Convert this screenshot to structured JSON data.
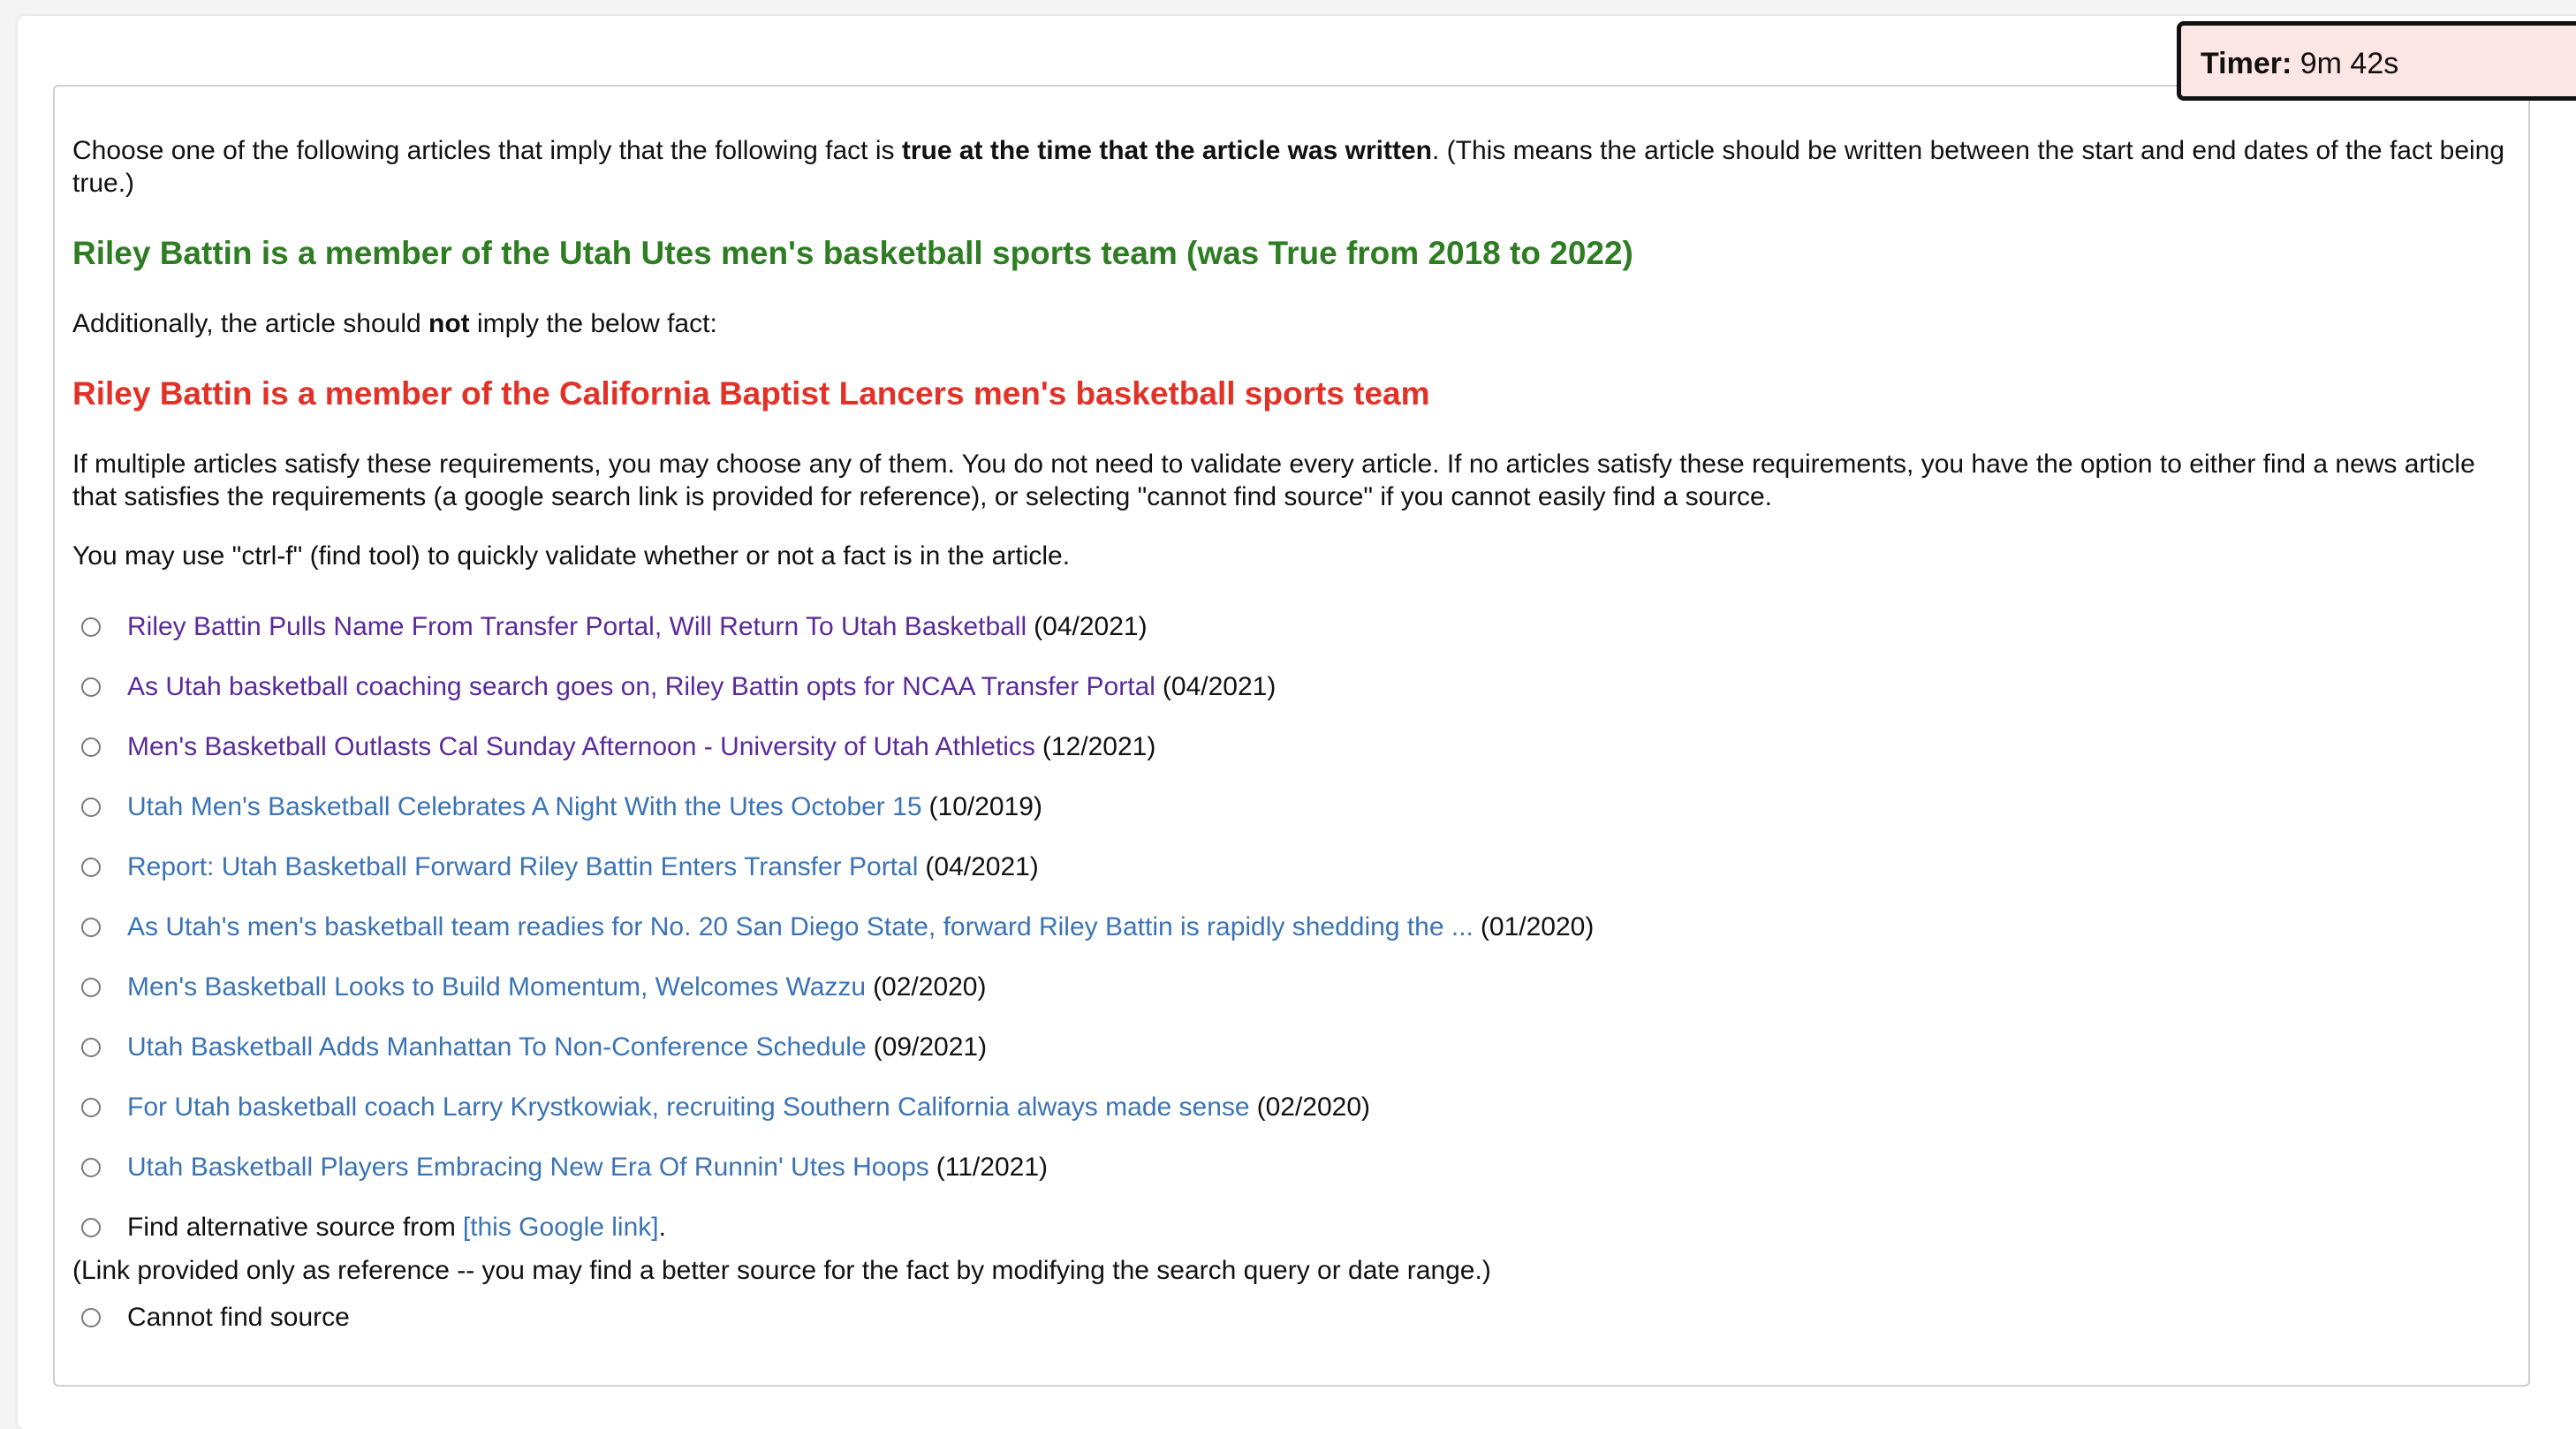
{
  "timer": {
    "label": "Timer:",
    "value": "9m 42s"
  },
  "instructions": {
    "p1_prefix": "Choose one of the following articles that imply that the following fact is ",
    "p1_bold": "true at the time that the article was written",
    "p1_suffix": ". (This means the article should be written between the start and end dates of the fact being true.)",
    "fact_true": "Riley Battin is a member of the Utah Utes men's basketball sports team (was True from 2018 to 2022)",
    "p2_prefix": "Additionally, the article should ",
    "p2_bold": "not",
    "p2_suffix": " imply the below fact:",
    "fact_false": "Riley Battin is a member of the California Baptist Lancers men's basketball sports team",
    "p3": "If multiple articles satisfy these requirements, you may choose any of them. You do not need to validate every article. If no articles satisfy these requirements, you have the option to either find a news article that satisfies the requirements (a google search link is provided for reference), or selecting \"cannot find source\" if you cannot easily find a source.",
    "p4": "You may use \"ctrl-f\" (find tool) to quickly validate whether or not a fact is in the article."
  },
  "articles": [
    {
      "title": "Riley Battin Pulls Name From Transfer Portal, Will Return To Utah Basketball",
      "date": "(04/2021)",
      "visited": true
    },
    {
      "title": "As Utah basketball coaching search goes on, Riley Battin opts for NCAA Transfer Portal",
      "date": "(04/2021)",
      "visited": true
    },
    {
      "title": "Men's Basketball Outlasts Cal Sunday Afternoon - University of Utah Athletics",
      "date": "(12/2021)",
      "visited": true
    },
    {
      "title": "Utah Men's Basketball Celebrates A Night With the Utes October 15",
      "date": "(10/2019)",
      "visited": false
    },
    {
      "title": "Report: Utah Basketball Forward Riley Battin Enters Transfer Portal",
      "date": "(04/2021)",
      "visited": false
    },
    {
      "title": "As Utah's men's basketball team readies for No. 20 San Diego State, forward Riley Battin is rapidly shedding the ...",
      "date": "(01/2020)",
      "visited": false
    },
    {
      "title": "Men's Basketball Looks to Build Momentum, Welcomes Wazzu",
      "date": "(02/2020)",
      "visited": false
    },
    {
      "title": "Utah Basketball Adds Manhattan To Non-Conference Schedule",
      "date": "(09/2021)",
      "visited": false
    },
    {
      "title": "For Utah basketball coach Larry Krystkowiak, recruiting Southern California always made sense",
      "date": "(02/2020)",
      "visited": false
    },
    {
      "title": "Utah Basketball Players Embracing New Era Of Runnin' Utes Hoops",
      "date": "(11/2021)",
      "visited": false
    }
  ],
  "alternative": {
    "prefix": "Find alternative source from ",
    "link": "[this Google link]",
    "suffix": ".",
    "note": "(Link provided only as reference -- you may find a better source for the fact by modifying the search query or date range.)"
  },
  "cannot_find": "Cannot find source",
  "colors": {
    "fact_true": "#2e7d23",
    "fact_false": "#e23228",
    "visited_link": "#5b2a9c",
    "link": "#3a74b6",
    "timer_bg": "#fbe5e5"
  }
}
